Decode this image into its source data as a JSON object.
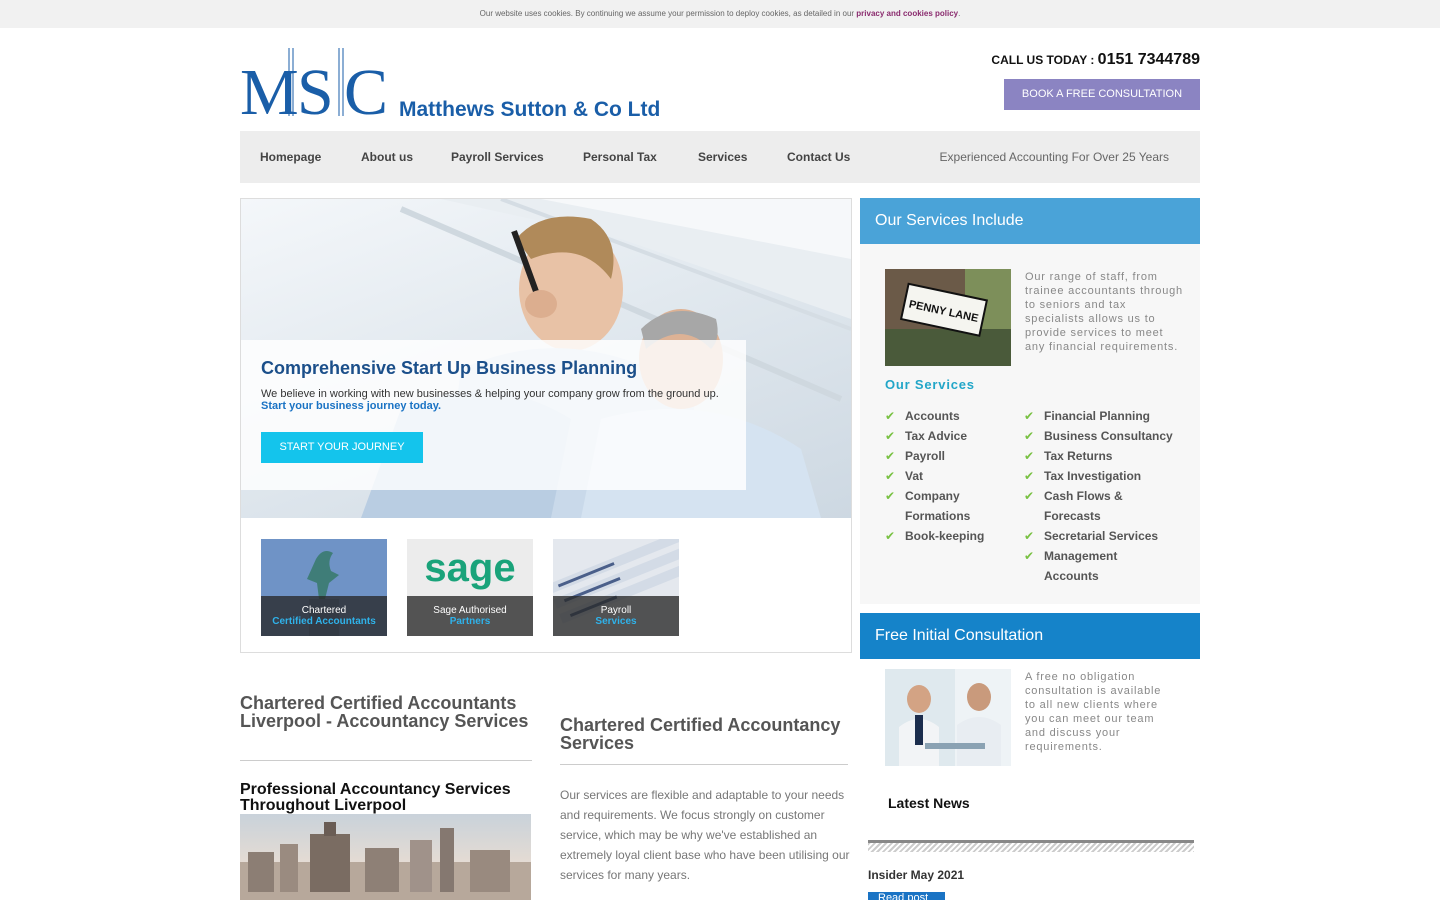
{
  "cookie_bar": {
    "text": "Our website uses cookies. By continuing we assume your permission to deploy cookies, as detailed in our",
    "link": "privacy and cookies policy",
    "end": "."
  },
  "header": {
    "company_name": "Matthews Sutton & Co Ltd",
    "call_label": "CALL US TODAY : ",
    "phone": "0151 7344789",
    "book_label": "BOOK A FREE CONSULTATION"
  },
  "nav": {
    "items": [
      "Homepage",
      "About us",
      "Payroll Services",
      "Personal Tax",
      "Services",
      "Contact Us"
    ],
    "tagline": "Experienced Accounting For Over 25 Years"
  },
  "hero": {
    "title": "Comprehensive Start Up Business Planning",
    "text": "We believe in working with new businesses & helping your company grow from the ground up. ",
    "link": "Start your business journey today.",
    "button": "START YOUR JOURNEY"
  },
  "thumbs": [
    {
      "line1": "Chartered",
      "line2": "Certified Accountants"
    },
    {
      "line1": "Sage Authorised",
      "line2": "Partners",
      "logo": "sage"
    },
    {
      "line1": "Payroll",
      "line2": "Services"
    }
  ],
  "left": {
    "heading": "Chartered Certified Accountants Liverpool - Accountancy Services",
    "subheading": "Professional Accountancy Services Throughout Liverpool"
  },
  "middle": {
    "heading": "Chartered Certified Accountancy Services",
    "text": "Our services are flexible and adaptable to your needs and requirements. We focus strongly on customer service, which may be why we've established an extremely loyal client base who have been utilising our services for many years."
  },
  "services_panel": {
    "title": "Our Services Include",
    "sign_text": "PENNY LANE",
    "description": "Our range of staff, from trainee accountants through to seniors and tax specialists allows us to provide services to meet any financial requirements.",
    "list_title": "Our Services",
    "col1": [
      "Accounts",
      "Tax Advice",
      "Payroll",
      "Vat",
      "Company Formations",
      "Book-keeping"
    ],
    "col2": [
      "Financial Planning",
      "Business Consultancy",
      "Tax Returns",
      "Tax Investigation",
      "Cash Flows & Forecasts",
      "Secretarial Services",
      "Management Accounts"
    ]
  },
  "consultation_panel": {
    "title": "Free Initial Consultation",
    "description": "A free no obligation consultation is available to all new clients where you can meet our team and discuss your requirements."
  },
  "news": {
    "title": "Latest News",
    "item": "Insider May 2021",
    "read_more": "Read post"
  },
  "colors": {
    "brand_blue": "#1a5ea8",
    "panel_light_blue": "#4aa3d8",
    "panel_blue": "#1583c9",
    "book_button": "#8b84c2",
    "cta_cyan": "#14c4ec",
    "tick_green": "#79c143"
  }
}
